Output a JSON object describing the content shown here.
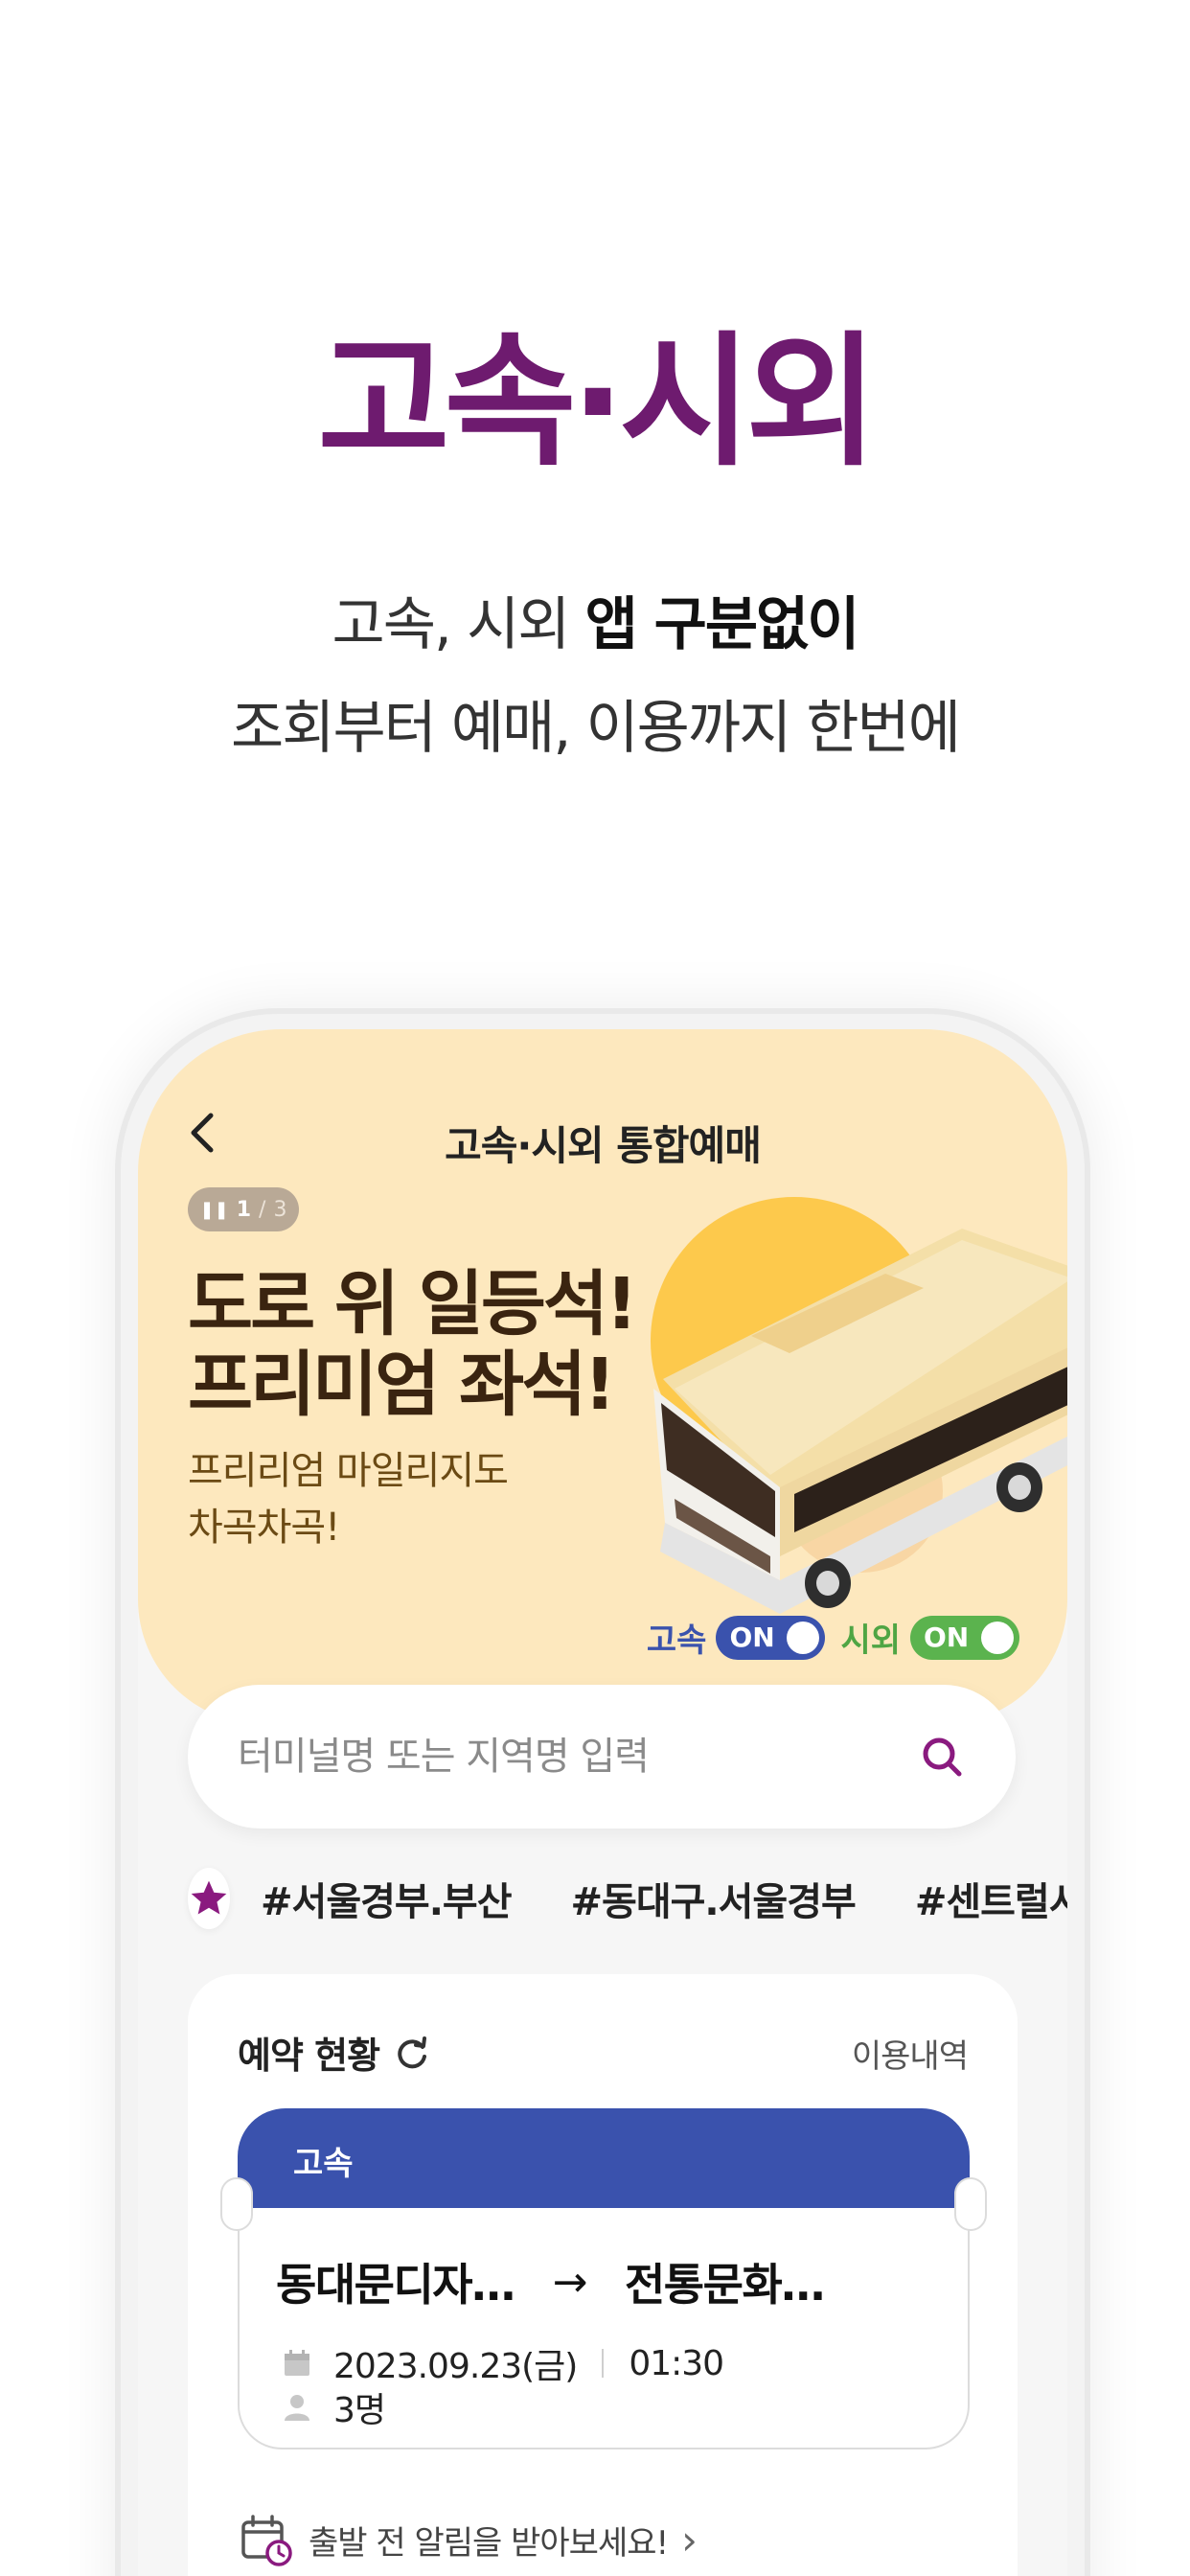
{
  "hero": {
    "title": "고속·시외",
    "line1_normal": "고속, 시외 ",
    "line1_bold": "앱 구분없이",
    "line2": "조회부터 예매, 이용까지 한번에"
  },
  "app": {
    "nav_title": "고속·시외 통합예매",
    "pager": {
      "current": "1",
      "total": "3"
    },
    "promo_title_line1": "도로 위 일등석!",
    "promo_title_line2": "프리미엄 좌석!",
    "promo_sub_line1": "프리리엄 마일리지도",
    "promo_sub_line2": "차곡차곡!",
    "modes": [
      {
        "label": "고속",
        "state": "ON",
        "color": "#3a52ad"
      },
      {
        "label": "시외",
        "state": "ON",
        "color": "#5bb34e"
      }
    ],
    "search": {
      "placeholder": "터미널명 또는 지역명 입력",
      "icon": "search-icon",
      "accent": "#8a1a7f"
    },
    "tags": [
      "#서울경부.부산",
      "#동대구.서울경부",
      "#센트럴시"
    ],
    "reservation": {
      "title": "예약 현황",
      "history_link": "이용내역",
      "ticket": {
        "type": "고속",
        "from": "동대문디자…",
        "arrow": "→",
        "to": "전통문화…",
        "date": "2023.09.23(금)",
        "time": "01:30",
        "passengers": "3명"
      },
      "alert_text": "출발 전 알림을 받아보세요!",
      "alert_chevron": "›"
    }
  },
  "colors": {
    "brand_purple": "#6e1b6f",
    "banner_bg": "#fde8be",
    "express_blue": "#3a52ad",
    "intercity_green": "#5bb34e"
  }
}
